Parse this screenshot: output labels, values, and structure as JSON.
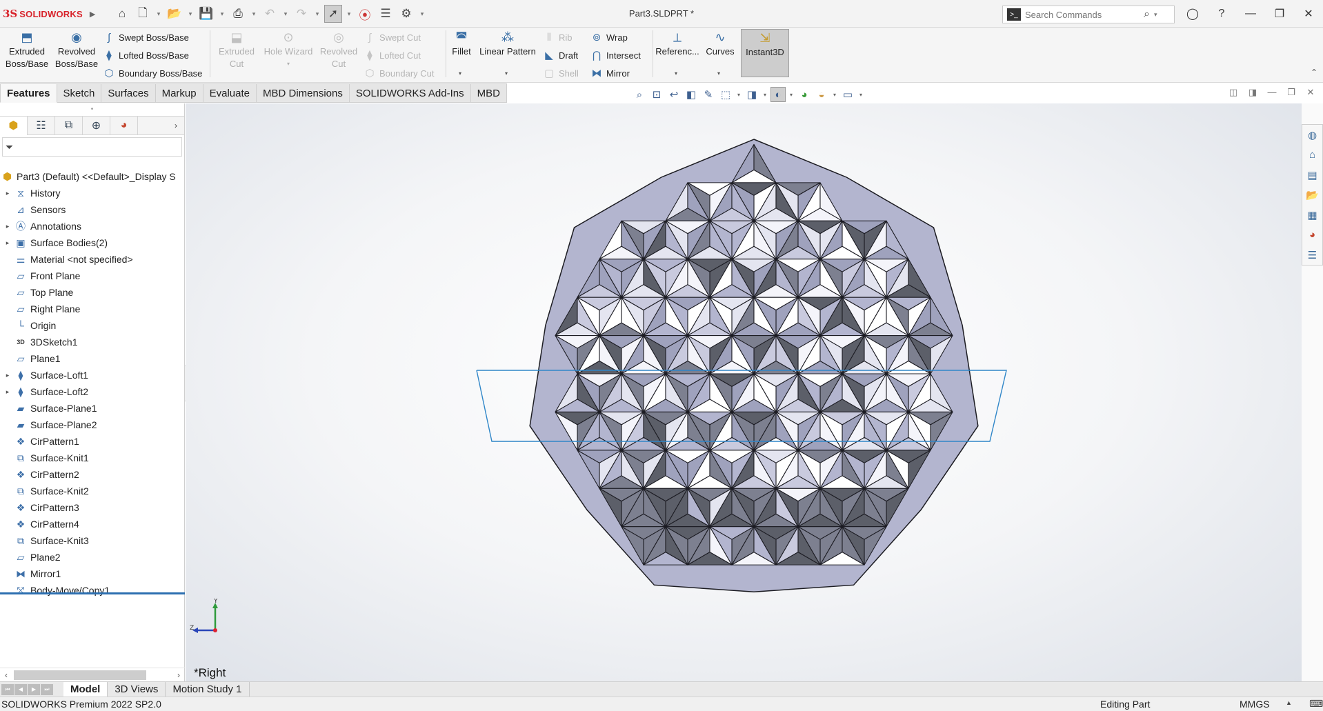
{
  "app": {
    "logo_mark": "3S",
    "logo_text": "SOLIDWORKS",
    "document_title": "Part3.SLDPRT *"
  },
  "search": {
    "placeholder": "Search Commands"
  },
  "ribbon": {
    "extruded_boss": "Extruded Boss/Base",
    "revolved_boss": "Revolved Boss/Base",
    "swept_boss": "Swept Boss/Base",
    "lofted_boss": "Lofted Boss/Base",
    "boundary_boss": "Boundary Boss/Base",
    "extruded_cut": "Extruded Cut",
    "hole_wizard": "Hole Wizard",
    "revolved_cut": "Revolved Cut",
    "swept_cut": "Swept Cut",
    "lofted_cut": "Lofted Cut",
    "boundary_cut": "Boundary Cut",
    "fillet": "Fillet",
    "linear_pattern": "Linear Pattern",
    "rib": "Rib",
    "draft": "Draft",
    "shell": "Shell",
    "wrap": "Wrap",
    "intersect": "Intersect",
    "mirror": "Mirror",
    "reference": "Referenc...",
    "curves": "Curves",
    "instant3d": "Instant3D"
  },
  "tabs": [
    "Features",
    "Sketch",
    "Surfaces",
    "Markup",
    "Evaluate",
    "MBD Dimensions",
    "SOLIDWORKS Add-Ins",
    "MBD"
  ],
  "tree": {
    "root": "Part3 (Default) <<Default>_Display S",
    "items": [
      {
        "label": "History",
        "expandable": true,
        "icon": "history-icon"
      },
      {
        "label": "Sensors",
        "expandable": false,
        "icon": "sensors-icon"
      },
      {
        "label": "Annotations",
        "expandable": true,
        "icon": "annotations-icon"
      },
      {
        "label": "Surface Bodies(2)",
        "expandable": true,
        "icon": "surface-bodies-icon"
      },
      {
        "label": "Material <not specified>",
        "expandable": false,
        "icon": "material-icon"
      },
      {
        "label": "Front Plane",
        "expandable": false,
        "icon": "plane-icon"
      },
      {
        "label": "Top Plane",
        "expandable": false,
        "icon": "plane-icon"
      },
      {
        "label": "Right Plane",
        "expandable": false,
        "icon": "plane-icon"
      },
      {
        "label": "Origin",
        "expandable": false,
        "icon": "origin-icon"
      },
      {
        "label": "3DSketch1",
        "expandable": false,
        "icon": "sketch3d-icon"
      },
      {
        "label": "Plane1",
        "expandable": false,
        "icon": "plane-icon"
      },
      {
        "label": "Surface-Loft1",
        "expandable": true,
        "icon": "loft-icon"
      },
      {
        "label": "Surface-Loft2",
        "expandable": true,
        "icon": "loft-icon"
      },
      {
        "label": "Surface-Plane1",
        "expandable": false,
        "icon": "surface-plane-icon"
      },
      {
        "label": "Surface-Plane2",
        "expandable": false,
        "icon": "surface-plane-icon"
      },
      {
        "label": "CirPattern1",
        "expandable": false,
        "icon": "circular-pattern-icon"
      },
      {
        "label": "Surface-Knit1",
        "expandable": false,
        "icon": "knit-icon"
      },
      {
        "label": "CirPattern2",
        "expandable": false,
        "icon": "circular-pattern-icon"
      },
      {
        "label": "Surface-Knit2",
        "expandable": false,
        "icon": "knit-icon"
      },
      {
        "label": "CirPattern3",
        "expandable": false,
        "icon": "circular-pattern-icon"
      },
      {
        "label": "CirPattern4",
        "expandable": false,
        "icon": "circular-pattern-icon"
      },
      {
        "label": "Surface-Knit3",
        "expandable": false,
        "icon": "knit-icon"
      },
      {
        "label": "Plane2",
        "expandable": false,
        "icon": "plane-icon"
      },
      {
        "label": "Mirror1",
        "expandable": false,
        "icon": "mirror-icon"
      },
      {
        "label": "Body-Move/Copy1",
        "expandable": false,
        "icon": "move-copy-icon"
      }
    ]
  },
  "triad": {
    "y_label": "Y",
    "z_label": "Z"
  },
  "viewport": {
    "view_name": "*Right"
  },
  "bottom_tabs": [
    "Model",
    "3D Views",
    "Motion Study 1"
  ],
  "status": {
    "product": "SOLIDWORKS Premium 2022 SP2.0",
    "mode": "Editing Part",
    "units": "MMGS"
  },
  "colors": {
    "brand": "#d8222a",
    "accent": "#2c6fb0",
    "facet_light": "#ffffff",
    "facet_mid": "#b3b5cf",
    "facet_dark": "#5c5f69",
    "selection_edge": "#2f86c8"
  }
}
